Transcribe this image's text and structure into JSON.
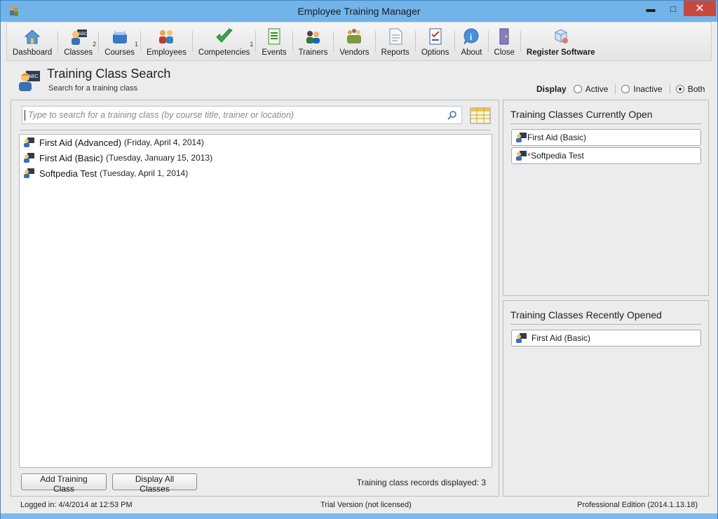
{
  "window": {
    "title": "Employee Training Manager",
    "minimize": "▬",
    "maximize": "□",
    "close": "✕"
  },
  "toolbar": {
    "items": [
      {
        "label": "Dashboard",
        "icon": "house-icon",
        "count": ""
      },
      {
        "label": "Classes",
        "icon": "teacher-icon",
        "count": "2"
      },
      {
        "label": "Courses",
        "icon": "books-icon",
        "count": "1"
      },
      {
        "label": "Employees",
        "icon": "people-icon",
        "count": ""
      },
      {
        "label": "Competencies",
        "icon": "checkmark-icon",
        "count": "1"
      },
      {
        "label": "Events",
        "icon": "list-icon",
        "count": ""
      },
      {
        "label": "Trainers",
        "icon": "trainers-icon",
        "count": ""
      },
      {
        "label": "Vendors",
        "icon": "vendors-icon",
        "count": ""
      },
      {
        "label": "Reports",
        "icon": "report-icon",
        "count": ""
      },
      {
        "label": "Options",
        "icon": "options-icon",
        "count": ""
      },
      {
        "label": "About",
        "icon": "info-icon",
        "count": ""
      },
      {
        "label": "Close",
        "icon": "door-icon",
        "count": ""
      },
      {
        "label": "Register Software",
        "icon": "register-icon",
        "count": ""
      }
    ]
  },
  "header": {
    "title": "Training Class Search",
    "subtitle": "Search for a training class"
  },
  "display": {
    "label": "Display",
    "options": [
      "Active",
      "Inactive",
      "Both"
    ],
    "selected": "Both"
  },
  "search": {
    "placeholder": "Type to search for a training class (by course title, trainer or location)",
    "value": ""
  },
  "classes": [
    {
      "title": "First Aid (Advanced)",
      "date": "(Friday, April 4, 2014)"
    },
    {
      "title": "First Aid (Basic)",
      "date": "(Tuesday, January 15, 2013)"
    },
    {
      "title": "Softpedia Test",
      "date": "(Tuesday, April 1, 2014)"
    }
  ],
  "buttons": {
    "add": "Add Training Class",
    "display_all": "Display All Classes"
  },
  "records": "Training class records displayed: 3",
  "open_panel": {
    "title": "Training Classes Currently Open",
    "items": [
      {
        "label": "First Aid (Basic)",
        "modified": ""
      },
      {
        "label": "Softpedia Test",
        "modified": "*"
      }
    ]
  },
  "recent_panel": {
    "title": "Training Classes Recently Opened",
    "items": [
      {
        "label": "First Aid (Basic)"
      }
    ]
  },
  "status": {
    "logged_in": "Logged in:  4/4/2014 at 12:53 PM",
    "trial": "Trial Version (not licensed)",
    "edition": "Professional Edition (2014.1.13.18)"
  },
  "colors": {
    "titlebar": "#72b4e9",
    "close_button": "#c7483f",
    "modified_star": "#d32a2a"
  }
}
